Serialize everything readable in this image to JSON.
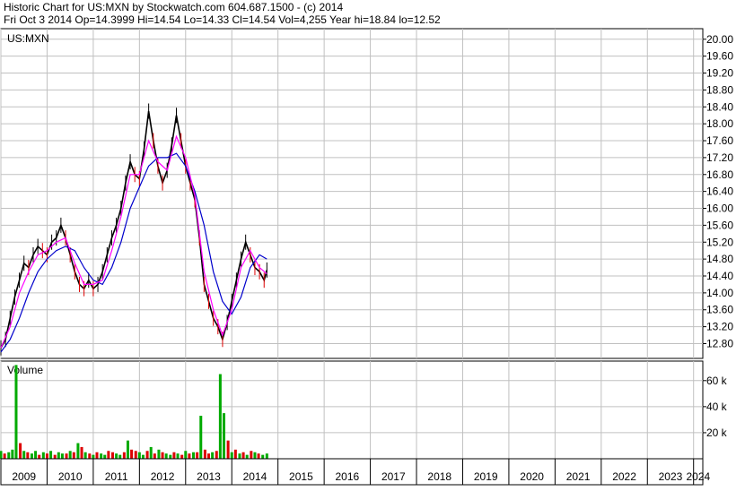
{
  "header": {
    "line1": "Historic Chart for US:MXN by Stockwatch.com 604.687.1500 - (c) 2014",
    "line2": "Fri Oct  3 2014  Op=14.3999  Hi=14.54  Lo=14.33  Cl=14.54  Vol=4,255  Year hi=18.84  lo=12.52"
  },
  "colors": {
    "up": "#00aa00",
    "down": "#dd0000",
    "price": "#000000",
    "ma_short": "#ff00ff",
    "ma_long": "#0000cc",
    "grid": "#c0c0c0"
  },
  "chart_data": [
    {
      "type": "line",
      "title": "US:MXN",
      "y_ticks": [
        "20.00",
        "19.60",
        "19.20",
        "18.80",
        "18.40",
        "18.00",
        "17.60",
        "17.20",
        "16.80",
        "16.40",
        "16.00",
        "15.60",
        "15.20",
        "14.80",
        "14.40",
        "14.00",
        "13.60",
        "13.20",
        "12.80"
      ],
      "ylim": [
        12.45,
        20.25
      ],
      "x_ticks": [
        "2009",
        "2010",
        "2011",
        "2012",
        "2013",
        "2014",
        "2015",
        "2016",
        "2017",
        "2018",
        "2019",
        "2020",
        "2021",
        "2022",
        "2023",
        "2024"
      ],
      "x_start": 2009.0,
      "x_end": 2024.2,
      "grid": true,
      "series": [
        {
          "role": "price",
          "color": "#000000",
          "x": [
            2009.0,
            2009.1,
            2009.2,
            2009.3,
            2009.4,
            2009.5,
            2009.6,
            2009.7,
            2009.8,
            2009.9,
            2010.0,
            2010.1,
            2010.2,
            2010.3,
            2010.4,
            2010.5,
            2010.6,
            2010.7,
            2010.8,
            2010.9,
            2011.0,
            2011.1,
            2011.2,
            2011.3,
            2011.4,
            2011.5,
            2011.6,
            2011.7,
            2011.8,
            2011.9,
            2012.0,
            2012.1,
            2012.2,
            2012.3,
            2012.4,
            2012.5,
            2012.6,
            2012.7,
            2012.8,
            2012.9,
            2013.0,
            2013.1,
            2013.2,
            2013.3,
            2013.4,
            2013.5,
            2013.6,
            2013.7,
            2013.8,
            2013.9,
            2014.0,
            2014.1,
            2014.2,
            2014.3,
            2014.4,
            2014.5,
            2014.6,
            2014.7,
            2014.76
          ],
          "values": [
            12.7,
            12.9,
            13.4,
            13.9,
            14.3,
            14.7,
            14.6,
            14.9,
            15.1,
            15.0,
            14.9,
            15.2,
            15.3,
            15.6,
            15.3,
            14.9,
            14.5,
            14.2,
            14.1,
            14.3,
            14.1,
            14.2,
            14.5,
            14.9,
            15.3,
            15.6,
            16.0,
            16.6,
            17.1,
            16.8,
            16.7,
            17.4,
            18.3,
            17.6,
            17.0,
            16.6,
            16.9,
            17.5,
            18.2,
            17.6,
            17.0,
            16.6,
            16.2,
            15.3,
            14.2,
            13.8,
            13.4,
            13.2,
            12.9,
            13.3,
            13.8,
            14.3,
            14.8,
            15.2,
            14.9,
            14.6,
            14.5,
            14.3,
            14.54
          ]
        },
        {
          "role": "ma_short",
          "color": "#ff00ff",
          "x": [
            2009.0,
            2009.2,
            2009.4,
            2009.6,
            2009.8,
            2010.0,
            2010.2,
            2010.4,
            2010.6,
            2010.8,
            2011.0,
            2011.2,
            2011.4,
            2011.6,
            2011.8,
            2012.0,
            2012.2,
            2012.4,
            2012.6,
            2012.8,
            2013.0,
            2013.2,
            2013.4,
            2013.6,
            2013.8,
            2014.0,
            2014.2,
            2014.4,
            2014.6,
            2014.76
          ],
          "values": [
            12.7,
            13.2,
            14.0,
            14.5,
            14.9,
            15.0,
            15.2,
            15.3,
            14.7,
            14.2,
            14.2,
            14.3,
            15.0,
            15.8,
            16.8,
            16.8,
            17.6,
            17.1,
            16.9,
            17.7,
            17.2,
            16.3,
            14.5,
            13.6,
            13.0,
            13.6,
            14.6,
            15.0,
            14.6,
            14.45
          ]
        },
        {
          "role": "ma_long",
          "color": "#0000cc",
          "x": [
            2009.0,
            2009.2,
            2009.4,
            2009.6,
            2009.8,
            2010.0,
            2010.2,
            2010.4,
            2010.6,
            2010.8,
            2011.0,
            2011.2,
            2011.4,
            2011.6,
            2011.8,
            2012.0,
            2012.2,
            2012.4,
            2012.6,
            2012.8,
            2013.0,
            2013.2,
            2013.4,
            2013.6,
            2013.8,
            2014.0,
            2014.2,
            2014.4,
            2014.6,
            2014.76
          ],
          "values": [
            12.6,
            12.9,
            13.4,
            14.0,
            14.5,
            14.8,
            15.0,
            15.1,
            15.0,
            14.6,
            14.3,
            14.2,
            14.6,
            15.2,
            16.0,
            16.5,
            17.0,
            17.2,
            17.2,
            17.3,
            17.0,
            16.4,
            15.6,
            14.5,
            13.8,
            13.5,
            13.9,
            14.6,
            14.9,
            14.8
          ]
        }
      ]
    },
    {
      "type": "bar",
      "title": "Volume",
      "y_ticks": [
        "60 k",
        "40 k",
        "20 k"
      ],
      "y_tick_values": [
        60000,
        40000,
        20000
      ],
      "ylim": [
        0,
        75000
      ],
      "x": [
        2009.0,
        2009.08,
        2009.17,
        2009.25,
        2009.33,
        2009.42,
        2009.5,
        2009.58,
        2009.67,
        2009.75,
        2009.83,
        2009.92,
        2010.0,
        2010.08,
        2010.17,
        2010.25,
        2010.33,
        2010.42,
        2010.5,
        2010.58,
        2010.67,
        2010.75,
        2010.83,
        2010.92,
        2011.0,
        2011.08,
        2011.17,
        2011.25,
        2011.33,
        2011.42,
        2011.5,
        2011.58,
        2011.67,
        2011.75,
        2011.83,
        2011.92,
        2012.0,
        2012.08,
        2012.17,
        2012.25,
        2012.33,
        2012.42,
        2012.5,
        2012.58,
        2012.67,
        2012.75,
        2012.83,
        2012.92,
        2013.0,
        2013.08,
        2013.17,
        2013.25,
        2013.33,
        2013.42,
        2013.5,
        2013.58,
        2013.67,
        2013.75,
        2013.83,
        2013.92,
        2014.0,
        2014.08,
        2014.17,
        2014.25,
        2014.33,
        2014.42,
        2014.5,
        2014.58,
        2014.67,
        2014.76
      ],
      "values": [
        6000,
        4000,
        5000,
        7000,
        72000,
        12000,
        6000,
        5000,
        4000,
        6000,
        3000,
        5000,
        4000,
        6000,
        3000,
        5000,
        4000,
        4000,
        6000,
        5000,
        12000,
        9000,
        5000,
        4000,
        3000,
        5000,
        4000,
        3000,
        6000,
        5000,
        4000,
        3000,
        5000,
        14000,
        7000,
        6000,
        5000,
        3000,
        6000,
        9000,
        4000,
        7000,
        5000,
        4000,
        3000,
        5000,
        4000,
        3000,
        6000,
        4000,
        5000,
        5000,
        33000,
        7000,
        4000,
        5000,
        6000,
        65000,
        35000,
        14000,
        5000,
        7000,
        4000,
        5000,
        3000,
        6000,
        5000,
        4000,
        3000,
        4000
      ],
      "up": [
        true,
        false,
        true,
        true,
        true,
        false,
        true,
        false,
        true,
        true,
        false,
        true,
        false,
        true,
        false,
        true,
        true,
        false,
        true,
        false,
        true,
        false,
        true,
        false,
        true,
        false,
        true,
        true,
        false,
        false,
        true,
        true,
        false,
        true,
        false,
        false,
        true,
        true,
        false,
        true,
        false,
        true,
        false,
        true,
        true,
        false,
        true,
        false,
        true,
        false,
        true,
        false,
        true,
        false,
        false,
        true,
        false,
        true,
        true,
        false,
        true,
        false,
        true,
        false,
        true,
        false,
        true,
        false,
        true,
        true
      ]
    }
  ]
}
